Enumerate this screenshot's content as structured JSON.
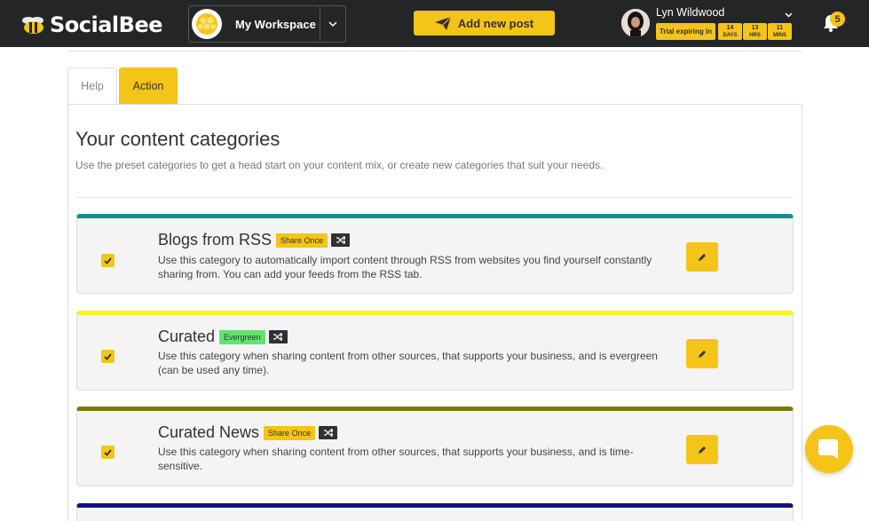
{
  "app": {
    "name": "SocialBee"
  },
  "workspace": {
    "name": "My Workspace"
  },
  "toolbar": {
    "add_post_label": "Add new post"
  },
  "user": {
    "name": "Lyn Wildwood",
    "trial_label": "Trial expiring in",
    "trial": [
      {
        "value": "14",
        "unit": "DAYS"
      },
      {
        "value": "13",
        "unit": "HRS"
      },
      {
        "value": "11",
        "unit": "MINS"
      }
    ]
  },
  "notifications": {
    "count": "5"
  },
  "tabs": [
    {
      "label": "Help"
    },
    {
      "label": "Action"
    }
  ],
  "page": {
    "title": "Your content categories",
    "subtitle": "Use the preset categories to get a head start on your content mix, or create new categories that suit your needs."
  },
  "colors": {
    "accent": "#f5c418",
    "navbar": "#242527",
    "evergreen": "#63e36e"
  },
  "categories": [
    {
      "title": "Blogs from RSS",
      "badge": "Share Once",
      "color": "#138f8a",
      "description": "Use this category to automatically import content through RSS from websites you find yourself constantly sharing from. You can add your feeds from the RSS tab."
    },
    {
      "title": "Curated",
      "badge": "Evergreen",
      "color": "#f6f51e",
      "description": "Use this category when sharing content from other sources, that supports your business, and is evergreen (can be used any time)."
    },
    {
      "title": "Curated News",
      "badge": "Share Once",
      "color": "#7b7a0c",
      "description": "Use this category when sharing content from other sources, that supports your business, and is time-sensitive."
    }
  ]
}
